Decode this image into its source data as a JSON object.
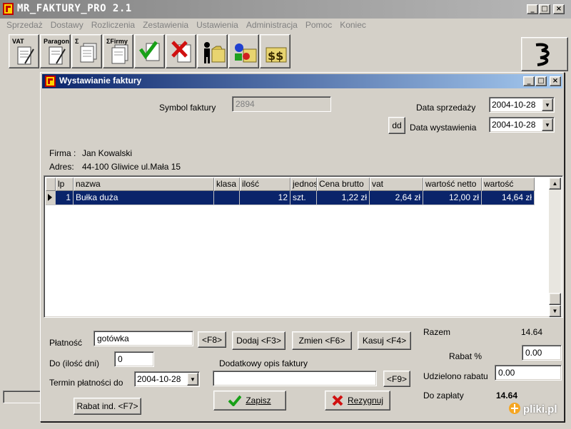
{
  "app": {
    "title": "MR_FAKTURY_PRO 2.1",
    "menu": [
      "Sprzedaż",
      "Dostawy",
      "Rozliczenia",
      "Zestawienia",
      "Ustawienia",
      "Administracja",
      "Pomoc",
      "Koniec"
    ],
    "toolbar": {
      "vat_label": "VAT",
      "paragon_label": "Paragon",
      "sigma_firmy_label": "ΣFirmy",
      "sigma_label": "Σ"
    }
  },
  "dialog": {
    "title": "Wystawianie faktury",
    "symbol_label": "Symbol faktury",
    "symbol_value": "2894",
    "sale_date_label": "Data sprzedaży",
    "sale_date_value": "2004-10-28",
    "issue_date_label": "Data wystawienia",
    "issue_date_value": "2004-10-28",
    "dd_label": "dd",
    "firm_label": "Firma :",
    "firm_value": "Jan Kowalski",
    "address_label": "Adres:",
    "address_value": "44-100 Gliwice ul.Mała 15",
    "table": {
      "columns": [
        "lp",
        "nazwa",
        "klasa",
        "ilość",
        "jednos",
        "Cena brutto",
        "vat",
        "wartość netto",
        "wartość"
      ],
      "rows": [
        [
          "1",
          "Bułka duża",
          "",
          "12",
          "szt.",
          "1,22 zł",
          "2,64 zł",
          "12,00 zł",
          "14,64 zł"
        ]
      ]
    },
    "payment_label": "Płatność",
    "payment_value": "gotówka",
    "f8_label": "<F8>",
    "days_label": "Do (ilość dni)",
    "days_value": "0",
    "due_label": "Termin płatności do",
    "due_value": "2004-10-28",
    "add_label": "Dodaj <F3>",
    "change_label": "Zmien <F6>",
    "delete_label": "Kasuj <F4>",
    "desc_label": "Dodatkowy opis faktury",
    "desc_value": "",
    "f9_label": "<F9>",
    "rabat_ind_label": "Rabat ind. <F7>",
    "save_label": "Zapisz",
    "cancel_label": "Rezygnuj",
    "total_label": "Razem",
    "total_value": "14.64",
    "rabat_pct_label": "Rabat %",
    "rabat_pct_value": "0.00",
    "granted_label": "Udzielono rabatu",
    "granted_value": "0.00",
    "to_pay_label": "Do zapłaty",
    "to_pay_value": "14.64"
  },
  "watermark": "pliki.pl"
}
